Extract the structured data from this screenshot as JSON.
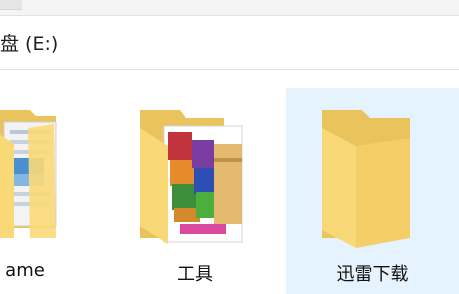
{
  "address": {
    "path_text": "盘 (E:)"
  },
  "folders": [
    {
      "label": "ame",
      "icon": "document-folder-icon",
      "selected": false
    },
    {
      "label": "工具",
      "icon": "winrar-folder-icon",
      "selected": false
    },
    {
      "label": "迅雷下载",
      "icon": "folder-icon",
      "selected": true
    }
  ],
  "colors": {
    "folder_back": "#e9c35c",
    "folder_front": "#f9d977",
    "selection": "#e5f3ff"
  }
}
